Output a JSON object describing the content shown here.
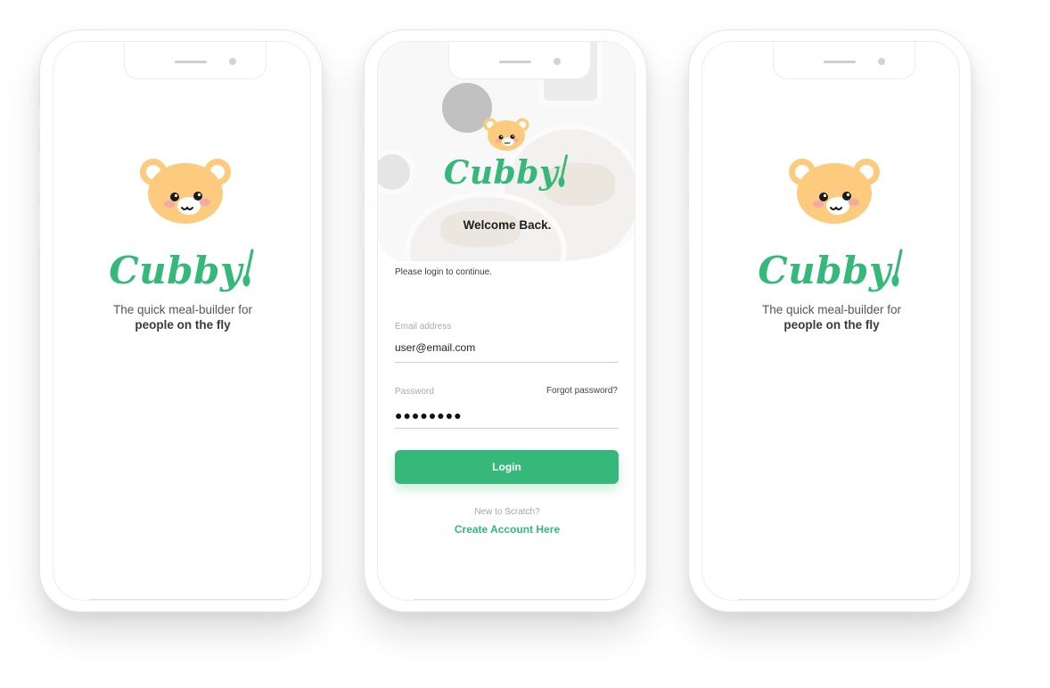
{
  "colors": {
    "brand_green": "#35b879",
    "bear_fur": "#fccb7e",
    "bear_inner_ear": "#ffffff",
    "blush": "#f6a7a7"
  },
  "splash_left": {
    "brand": "Cubby",
    "tagline_line1": "The quick meal-builder for",
    "tagline_line2": "people on the fly",
    "logo_icon": "bear-face-icon"
  },
  "login": {
    "brand": "Cubby",
    "welcome": "Welcome Back.",
    "subtitle": "Please login to continue.",
    "email": {
      "label": "Email address",
      "value": "user@email.com"
    },
    "password": {
      "label": "Password",
      "value": "●●●●●●●●",
      "forgot": "Forgot password?"
    },
    "login_button": "Login",
    "new_prompt": "New to Scratch?",
    "create_link": "Create Account Here"
  },
  "splash_right": {
    "brand": "Cubby",
    "tagline_line1": "The quick meal-builder for",
    "tagline_line2": "people on the fly",
    "logo_icon": "bear-face-icon"
  }
}
